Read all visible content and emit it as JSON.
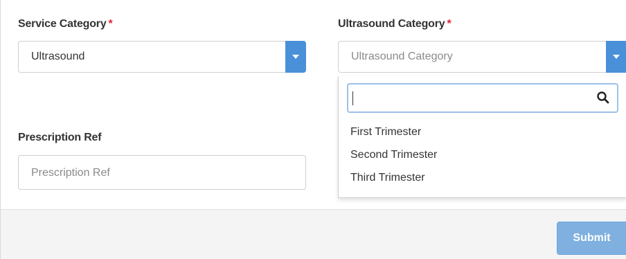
{
  "form": {
    "service_category": {
      "label": "Service Category",
      "required_mark": "*",
      "value": "Ultrasound"
    },
    "ultrasound_category": {
      "label": "Ultrasound Category",
      "required_mark": "*",
      "placeholder": "Ultrasound Category",
      "search_value": "",
      "options": [
        "First Trimester",
        "Second Trimester",
        "Third Trimester"
      ]
    },
    "prescription_ref": {
      "label": "Prescription Ref",
      "placeholder": "Prescription Ref"
    }
  },
  "footer": {
    "submit_label": "Submit"
  },
  "colors": {
    "required": "#e0242f",
    "caret_button": "#4a90d9",
    "submit_button": "#7fb0e0",
    "search_focus_border": "#9cc0ea"
  }
}
